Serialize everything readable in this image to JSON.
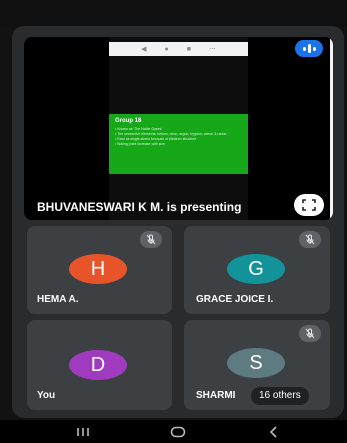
{
  "presentation": {
    "presenting_text": "BHUVANESWARI K M. is presenting",
    "slide": {
      "title": "Group 18",
      "lines": [
        "• Known as 'The Noble Gases'",
        "• The unreactive elements: helium, neon, argon, krypton, xenon & radon",
        "• Exist as single atoms because of electron structure",
        "• Boiling point increase with size"
      ]
    }
  },
  "participants": [
    {
      "initial": "H",
      "name": "HEMA A.",
      "color": "#e8542a",
      "muted": true
    },
    {
      "initial": "G",
      "name": "GRACE JOICE I.",
      "color": "#12939a",
      "muted": true
    },
    {
      "initial": "D",
      "name": "You",
      "color": "#a03bbf",
      "muted": false
    },
    {
      "initial": "S",
      "name": "SHARMI",
      "color": "#5f7b82",
      "muted": true
    }
  ],
  "others_label": "16 others",
  "colors": {
    "accent": "#1a73e8",
    "tile": "#3c4043",
    "panel": "#2a2b2d"
  },
  "icons": [
    "mic-off-icon",
    "speaking-indicator-icon",
    "fullscreen-icon",
    "recents-icon",
    "home-icon",
    "back-icon"
  ]
}
